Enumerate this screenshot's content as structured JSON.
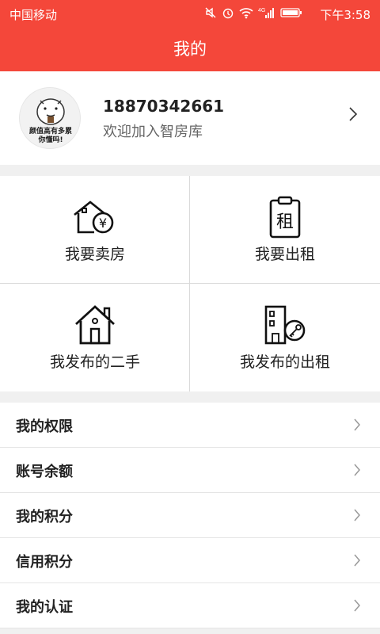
{
  "status": {
    "carrier": "中国移动",
    "network": "4G",
    "time": "下午3:58"
  },
  "header": {
    "title": "我的"
  },
  "profile": {
    "phone": "18870342661",
    "subtitle": "欢迎加入智房库",
    "avatar_caption_line1": "颜值高有多累",
    "avatar_caption_line2": "你懂吗!"
  },
  "grid": [
    {
      "label": "我要卖房",
      "icon": "house-yen-icon",
      "char": "¥"
    },
    {
      "label": "我要出租",
      "icon": "rent-clipboard-icon",
      "char": "租"
    },
    {
      "label": "我发布的二手",
      "icon": "house-icon"
    },
    {
      "label": "我发布的出租",
      "icon": "building-key-icon"
    }
  ],
  "menu": [
    {
      "label": "我的权限"
    },
    {
      "label": "账号余额"
    },
    {
      "label": "我的积分"
    },
    {
      "label": "信用积分"
    },
    {
      "label": "我的认证"
    }
  ],
  "colors": {
    "brand": "#f4473a",
    "text": "#222222",
    "subtext": "#666666"
  }
}
